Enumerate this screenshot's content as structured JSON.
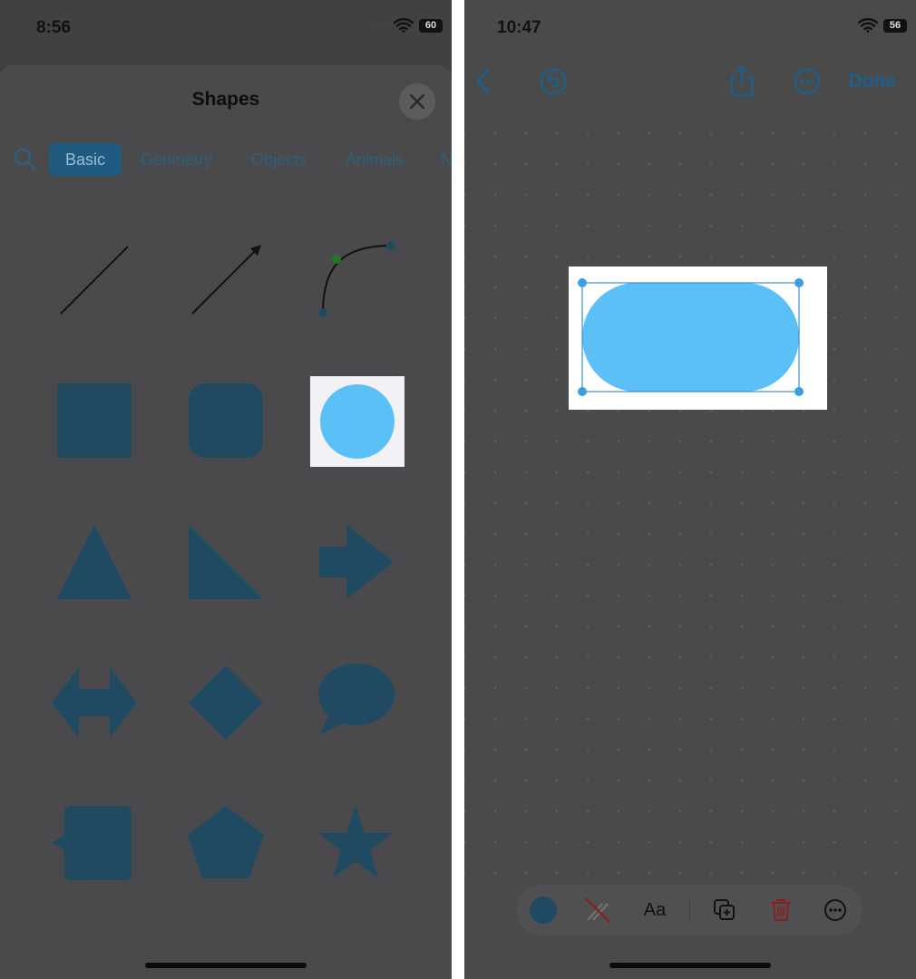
{
  "left_screen": {
    "status": {
      "time": "8:56",
      "battery": "60"
    },
    "sheet": {
      "title": "Shapes",
      "tabs": [
        {
          "label": "Basic",
          "active": true
        },
        {
          "label": "Geometry",
          "active": false
        },
        {
          "label": "Objects",
          "active": false
        },
        {
          "label": "Animals",
          "active": false
        },
        {
          "label": "N",
          "active": false
        }
      ],
      "shapes": [
        "line",
        "arrow",
        "curve",
        "square",
        "rounded-square",
        "circle",
        "triangle",
        "right-triangle",
        "arrow-right",
        "double-arrow",
        "diamond",
        "speech-bubble",
        "callout-square",
        "pentagon",
        "star"
      ],
      "selected_shape": "circle"
    }
  },
  "right_screen": {
    "status": {
      "time": "10:47",
      "battery": "56"
    },
    "nav": {
      "done_label": "Done"
    },
    "toolbar": {
      "text_style_label": "Aa"
    }
  },
  "colors": {
    "shape_fill": "#1f4a61",
    "selected_fill": "#5bc0f5",
    "accent": "#1d5f8a",
    "delete": "#8b1f1f"
  }
}
